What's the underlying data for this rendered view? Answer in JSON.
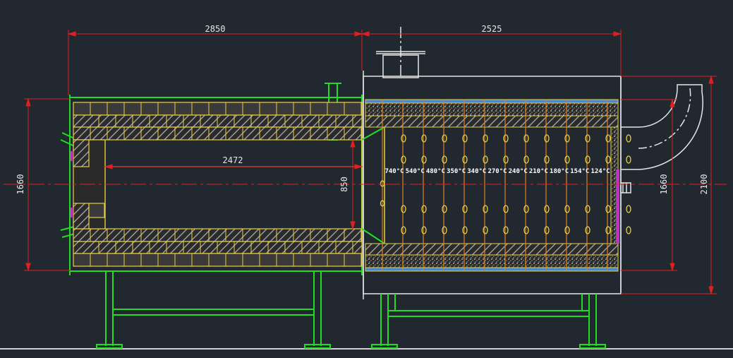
{
  "dimensions": {
    "left_length": "2850",
    "right_length": "2525",
    "tube_length": "2472",
    "inner_height": "850",
    "left_height": "1660",
    "right_inner_height": "1660",
    "right_total_height": "2100"
  },
  "temperatures": [
    "740°C",
    "540°C",
    "480°C",
    "350°C",
    "340°C",
    "270°C",
    "240°C",
    "210°C",
    "180°C",
    "154°C",
    "124°C"
  ],
  "colors": {
    "background": "#212830",
    "outline_green": "#22dd22",
    "dimension_red": "#e02020",
    "refractory_yellow": "#e8d040",
    "brick_fill": "#3a3a3a",
    "tube_orange": "#e08020",
    "shell_white": "#e6e6e6",
    "insulation_blue": "#4a88c8",
    "magenta": "#c030c0"
  }
}
